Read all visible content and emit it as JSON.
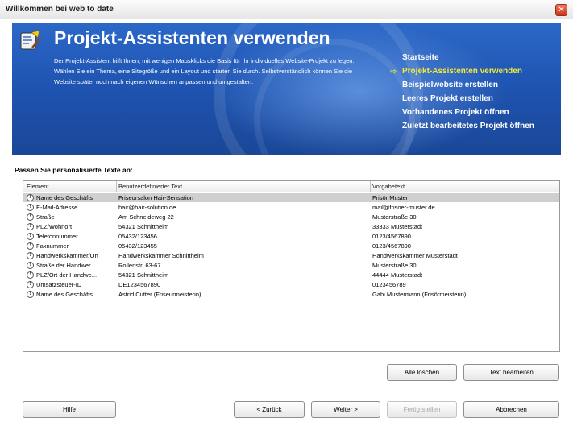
{
  "window": {
    "title": "Willkommen bei web to date"
  },
  "banner": {
    "title": "Projekt-Assistenten verwenden",
    "description": "Der Projekt-Assistent hilft Ihnen, mit wenigen Mausklicks die Basis für Ihr individuelles Website-Projekt zu legen. Wählen Sie ein Thema, eine Sitegröße und ein Layout und starten Sie durch. Selbstverständlich können Sie die Website später noch nach eigenen Wünschen anpassen und umgestalten.",
    "nav": [
      {
        "label": "Startseite",
        "active": false
      },
      {
        "label": "Projekt-Assistenten verwenden",
        "active": true
      },
      {
        "label": "Beispielwebsite erstellen",
        "active": false
      },
      {
        "label": "Leeres Projekt erstellen",
        "active": false
      },
      {
        "label": "Vorhandenes Projekt öffnen",
        "active": false
      },
      {
        "label": "Zuletzt bearbeitetes Projekt öffnen",
        "active": false
      }
    ],
    "nav_arrow": "⇨",
    "icon": "wizard-icon"
  },
  "section_label": "Passen Sie personalisierte Texte an:",
  "table": {
    "columns": [
      "Element",
      "Benutzerdefinierter Text",
      "Vorgabetext"
    ],
    "rows": [
      {
        "element": "Name des Geschäfts",
        "custom": "Friseursalon Hair-Sensation",
        "default": "Frisör Muster",
        "selected": true
      },
      {
        "element": "E-Mail-Adresse",
        "custom": "hair@hair-solution.de",
        "default": "mail@frisoer-muster.de"
      },
      {
        "element": "Straße",
        "custom": "Am Schneideweg 22",
        "default": "Musterstraße 30"
      },
      {
        "element": "PLZ/Wohnort",
        "custom": "54321 Schnittheim",
        "default": "33333 Musterstadt"
      },
      {
        "element": "Telefonnummer",
        "custom": "05432/123456",
        "default": "0123/4567890"
      },
      {
        "element": "Faxnummer",
        "custom": "05432/123455",
        "default": "0123/4567890"
      },
      {
        "element": "Handwerkskammer/Ort",
        "custom": "Handwerkskammer Schnittheim",
        "default": "Handwerkskammer Musterstadt"
      },
      {
        "element": "Straße der Handwer...",
        "custom": "Rollenstr. 63-67",
        "default": "Musterstraße 30"
      },
      {
        "element": "PLZ/Ort der Handwe...",
        "custom": "54321 Schnittheim",
        "default": "44444 Musterstadt"
      },
      {
        "element": "Umsatzsteuer-ID",
        "custom": "DE1234567890",
        "default": "0123456789"
      },
      {
        "element": "Name des Geschäfts...",
        "custom": "Astrid Cutter (Friseurmeisterin)",
        "default": "Gabi Mustermann (Frisörmeisterin)"
      }
    ]
  },
  "buttons": {
    "clear_all": "Alle löschen",
    "edit_text": "Text bearbeiten",
    "help": "Hilfe",
    "back": "< Zurück",
    "next": "Weiter >",
    "finish": "Fertig stellen",
    "cancel": "Abbrechen",
    "close": "✕"
  }
}
